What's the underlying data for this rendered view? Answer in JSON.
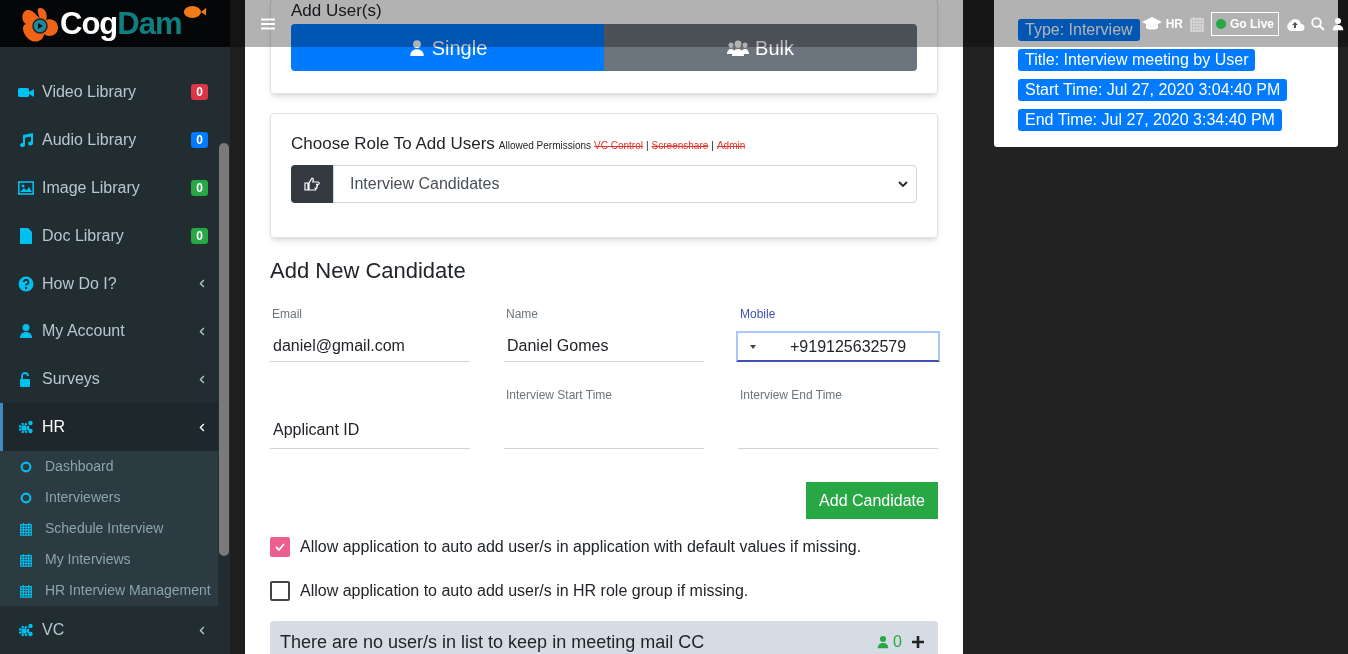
{
  "header": {
    "logo": {
      "text_1": "Cog",
      "text_2": "Dam"
    },
    "hr_label": "HR",
    "go_live": "Go Live"
  },
  "sidebar": {
    "items": [
      {
        "label": "Video Library",
        "selected": false,
        "has_submenu": false,
        "badge": {
          "text": "0",
          "color": "#dc3545"
        }
      },
      {
        "label": "Audio Library",
        "selected": false,
        "has_submenu": false,
        "badge": {
          "text": "0",
          "color": "#007bff"
        }
      },
      {
        "label": "Image Library",
        "selected": false,
        "has_submenu": false,
        "badge": {
          "text": "0",
          "color": "#28a745"
        }
      },
      {
        "label": "Doc Library",
        "selected": false,
        "has_submenu": false,
        "badge": {
          "text": "0",
          "color": "#28a745"
        }
      },
      {
        "label": "How Do I?",
        "selected": false,
        "has_submenu": true
      },
      {
        "label": "My Account",
        "selected": false,
        "has_submenu": true
      },
      {
        "label": "Surveys",
        "selected": false,
        "has_submenu": true
      },
      {
        "label": "HR",
        "selected": true,
        "has_submenu": true,
        "expanded": true,
        "children": [
          {
            "label": "Dashboard",
            "kind": "circle"
          },
          {
            "label": "Interviewers",
            "kind": "circle"
          },
          {
            "label": "Schedule Interview",
            "kind": "calendar"
          },
          {
            "label": "My Interviews",
            "kind": "calendar"
          },
          {
            "label": "HR Interview Management",
            "kind": "calendar"
          }
        ]
      },
      {
        "label": "VC",
        "selected": false,
        "has_submenu": true,
        "expanded": false
      }
    ]
  },
  "add_users": {
    "title": "Add User(s)",
    "options": [
      {
        "label": "Single",
        "selected": true
      },
      {
        "label": "Bulk",
        "selected": false
      }
    ]
  },
  "role": {
    "title": "Choose Role To Add Users",
    "permissions_label": "Allowed Permissions",
    "permissions": [
      {
        "label": "VC Control",
        "allowed": false
      },
      {
        "label": "Screenshare",
        "allowed": false
      },
      {
        "label": "Admin",
        "allowed": false
      }
    ],
    "separators": [
      "|",
      "|"
    ],
    "select_value": "Interview Candidates"
  },
  "candidate_form": {
    "title": "Add New Candidate",
    "fields": [
      {
        "label": "Email",
        "value": "daniel@gmail.com",
        "kind": "text",
        "focused": false
      },
      {
        "label": "Name",
        "value": "Daniel Gomes",
        "kind": "text",
        "focused": false
      },
      {
        "label": "Mobile",
        "value": "+919125632579",
        "kind": "phone",
        "focused": true
      },
      {
        "placeholder": "Applicant ID",
        "kind": "text",
        "focused": false
      },
      {
        "label": "Interview Start Time",
        "kind": "text",
        "focused": false
      },
      {
        "label": "Interview End Time",
        "kind": "text",
        "focused": false
      }
    ],
    "submit": "Add Candidate"
  },
  "options": [
    {
      "label": "Allow application to auto add user/s in application with default values if missing.",
      "checked": true
    },
    {
      "label": "Allow application to auto add user/s in HR role group if missing.",
      "checked": false
    }
  ],
  "cc_bar": {
    "text": "There are no user/s in list to keep in meeting mail CC",
    "count": "0"
  },
  "meeting_info": [
    "Type: Interview",
    "Title: Interview meeting by User",
    "Start Time: Jul 27, 2020 3:04:40 PM",
    "End Time: Jul 27, 2020 3:34:40 PM"
  ]
}
